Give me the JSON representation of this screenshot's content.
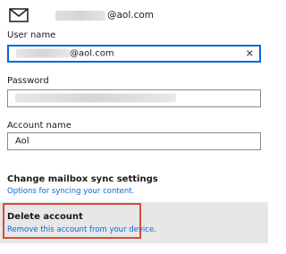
{
  "header": {
    "email_suffix": "@aol.com",
    "envelope_icon": "envelope-icon"
  },
  "form": {
    "username_label": "User name",
    "username_suffix": "@aol.com",
    "clear_icon": "clear-x-icon",
    "clear_glyph": "✕",
    "password_label": "Password",
    "account_name_label": "Account name",
    "account_name_value": "Aol"
  },
  "sync": {
    "title": "Change mailbox sync settings",
    "link": "Options for syncing your content."
  },
  "delete": {
    "title": "Delete account",
    "link": "Remove this account from your device."
  },
  "colors": {
    "accent": "#0a66d8",
    "highlight": "#d94a3a",
    "band": "#e7e7e7"
  }
}
